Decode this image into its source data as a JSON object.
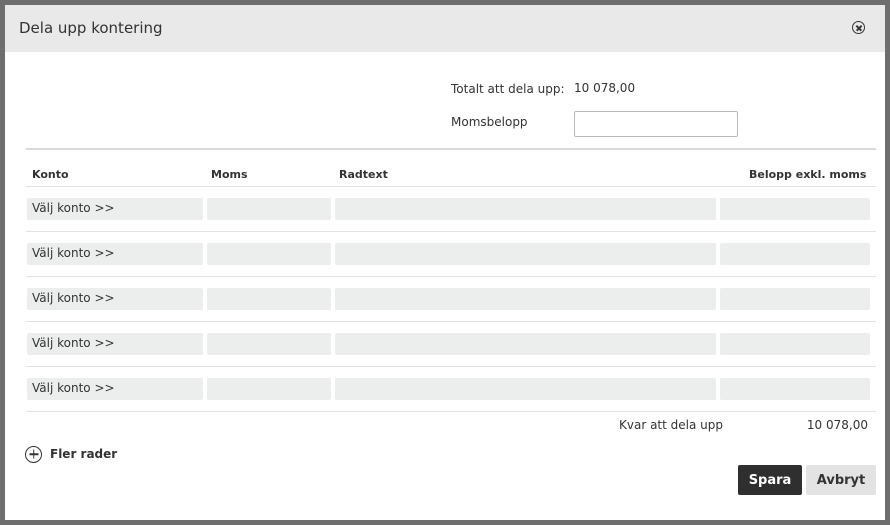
{
  "dialog": {
    "title": "Dela upp kontering",
    "close_icon": "close-circle-icon"
  },
  "summary": {
    "total_label": "Totalt att dela upp:",
    "total_value": "10 078,00",
    "moms_label": "Momsbelopp",
    "moms_value": "",
    "moms_placeholder": ""
  },
  "table": {
    "headers": {
      "konto": "Konto",
      "moms": "Moms",
      "radtext": "Radtext",
      "belopp": "Belopp exkl. moms"
    },
    "rows": [
      {
        "konto": "Välj konto >>",
        "moms": "",
        "radtext": "",
        "belopp": ""
      },
      {
        "konto": "Välj konto >>",
        "moms": "",
        "radtext": "",
        "belopp": ""
      },
      {
        "konto": "Välj konto >>",
        "moms": "",
        "radtext": "",
        "belopp": ""
      },
      {
        "konto": "Välj konto >>",
        "moms": "",
        "radtext": "",
        "belopp": ""
      },
      {
        "konto": "Välj konto >>",
        "moms": "",
        "radtext": "",
        "belopp": ""
      }
    ],
    "remaining_label": "Kvar att dela upp",
    "remaining_value": "10 078,00"
  },
  "actions": {
    "more_rows_label": "Fler rader",
    "more_rows_icon": "plus-circle-icon",
    "save_label": "Spara",
    "cancel_label": "Avbryt"
  }
}
